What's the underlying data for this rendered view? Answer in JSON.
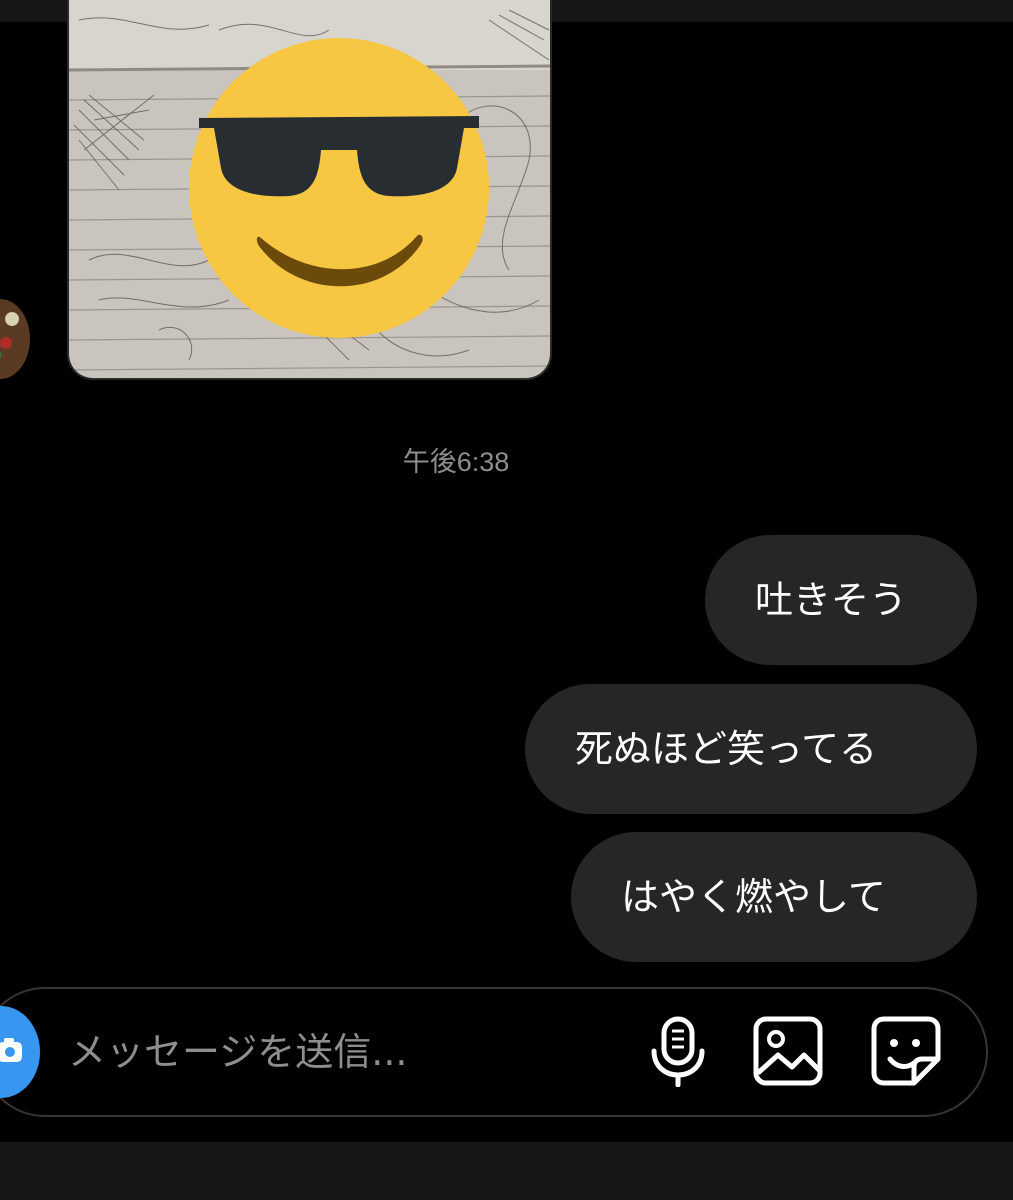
{
  "conversation": {
    "photo_message": {
      "icon": "sunglasses-face-icon"
    },
    "timestamp": "午後6:38",
    "messages": [
      {
        "text": "吐きそう"
      },
      {
        "text": "死ぬほど笑ってる"
      },
      {
        "text": "はやく燃やして"
      }
    ]
  },
  "composer": {
    "placeholder": "メッセージを送信...",
    "icons": [
      "camera-icon",
      "microphone-icon",
      "image-icon",
      "sticker-icon"
    ]
  },
  "colors": {
    "background": "#000000",
    "bubble": "#262626",
    "accent": "#3797f0",
    "muted_text": "#8e8e8e",
    "emoji_face": "#f7c643"
  }
}
